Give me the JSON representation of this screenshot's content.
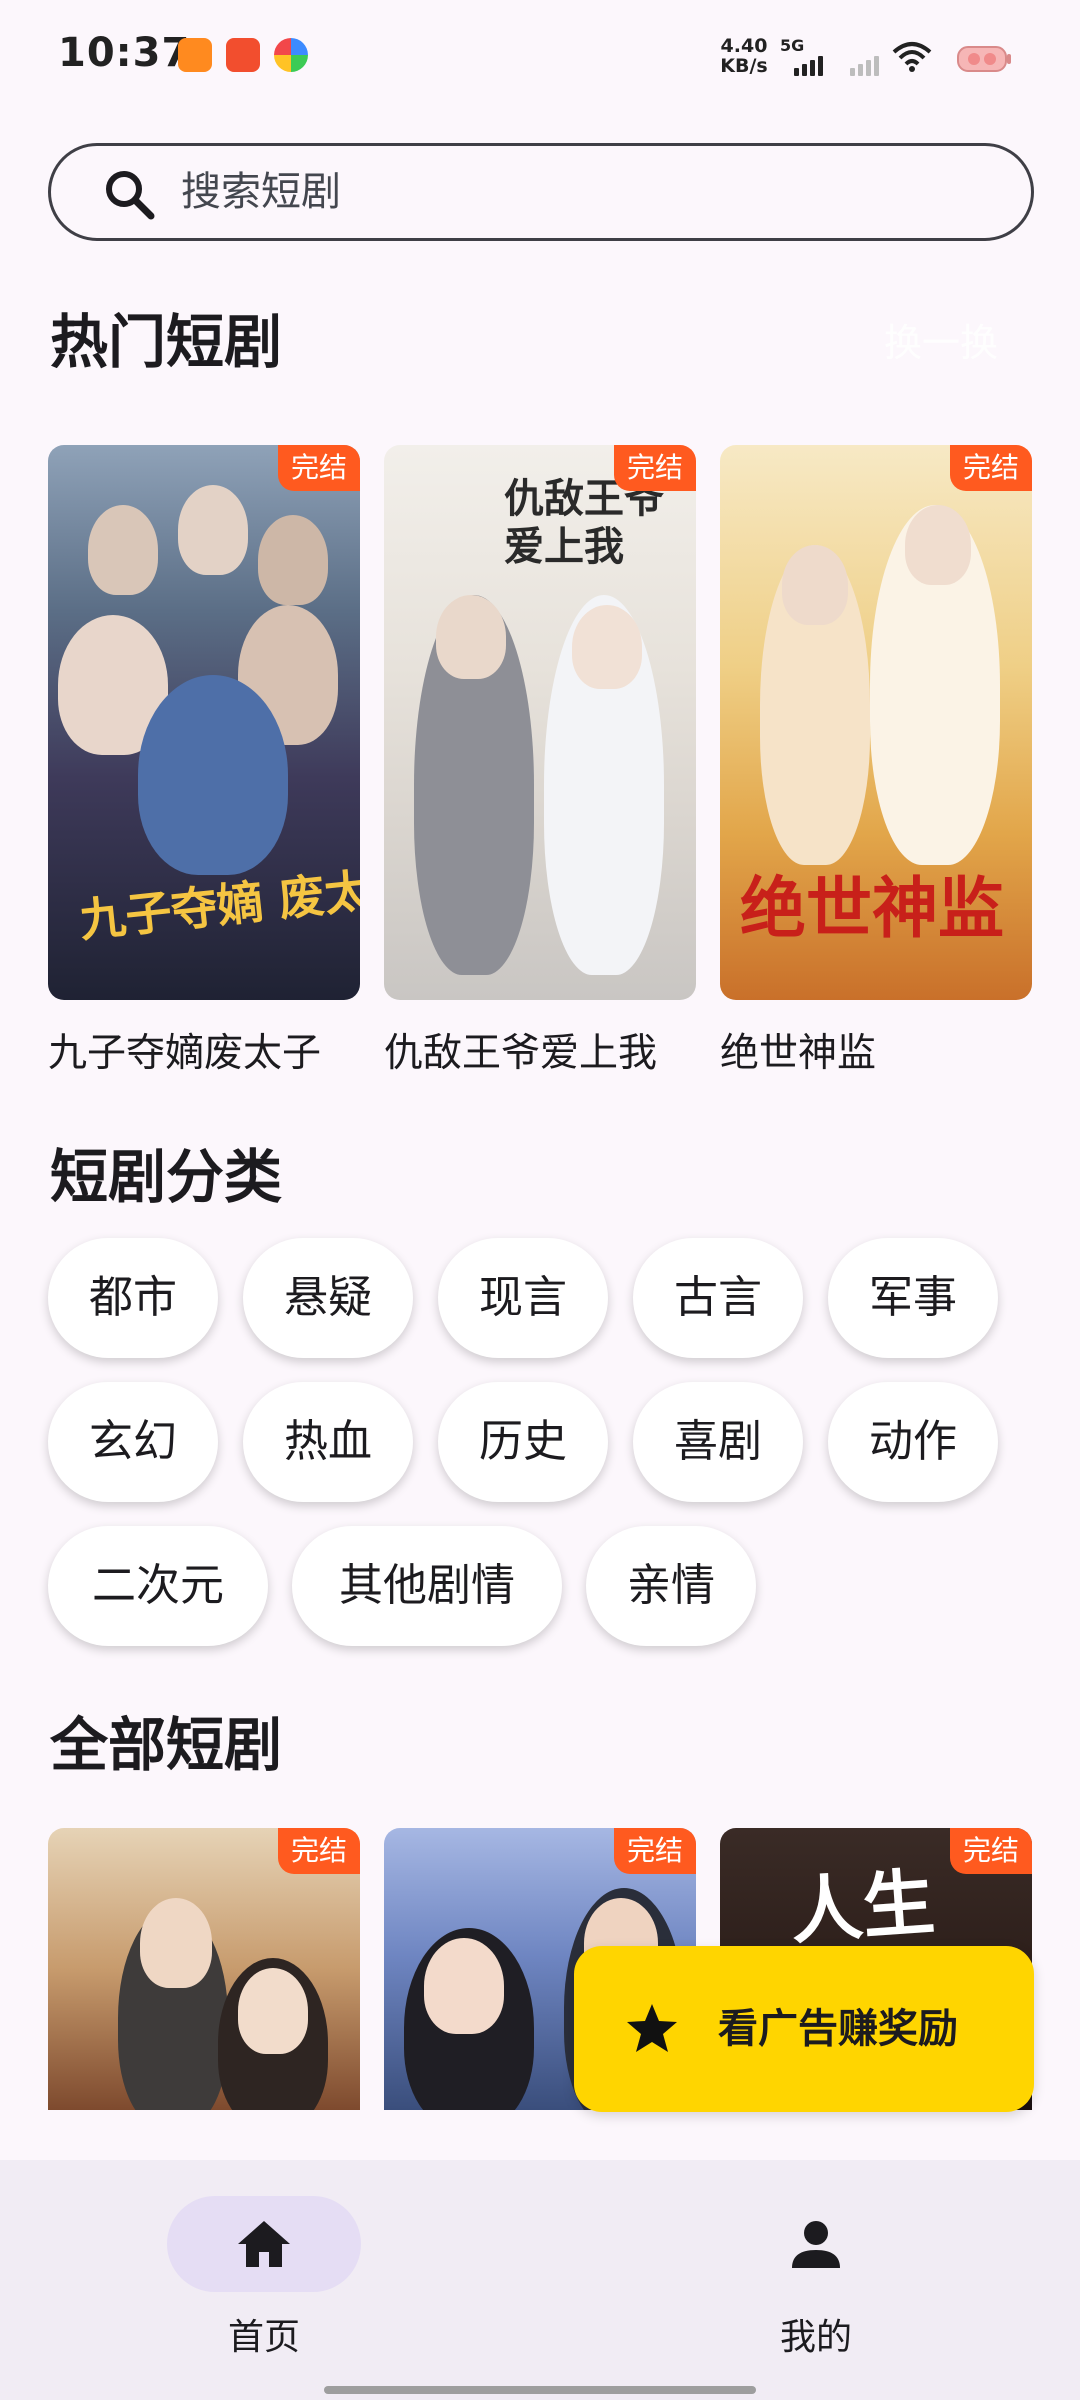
{
  "status_bar": {
    "time": "10:37",
    "net_speed_value": "4.40",
    "net_speed_unit": "KB/s",
    "network": "5G"
  },
  "search": {
    "placeholder": "搜索短剧"
  },
  "hot": {
    "title": "热门短剧",
    "action_label": "换一换",
    "items": [
      {
        "title": "九子夺嫡废太子",
        "badge": "完结",
        "poster_text": "九子夺嫡 废太子竟是修仙者"
      },
      {
        "title": "仇敌王爷爱上我",
        "badge": "完结",
        "poster_text": "仇敌王爷爱上我"
      },
      {
        "title": "绝世神监",
        "badge": "完结",
        "poster_text": "绝世神监"
      }
    ]
  },
  "categories": {
    "title": "短剧分类",
    "items": [
      "都市",
      "悬疑",
      "现言",
      "古言",
      "军事",
      "玄幻",
      "热血",
      "历史",
      "喜剧",
      "动作",
      "二次元",
      "其他剧情",
      "亲情"
    ]
  },
  "all": {
    "title": "全部短剧",
    "items": [
      {
        "badge": "完结"
      },
      {
        "badge": "完结"
      },
      {
        "badge": "完结",
        "poster_text": "人生"
      }
    ]
  },
  "reward": {
    "label": "看广告赚奖励",
    "icon": "star-icon"
  },
  "nav": {
    "items": [
      {
        "label": "首页",
        "icon": "home-icon",
        "active": true
      },
      {
        "label": "我的",
        "icon": "person-icon",
        "active": false
      }
    ]
  },
  "colors": {
    "background": "#FCF7FC",
    "badge": "#FF5A1F",
    "reward": "#FFD500",
    "nav_active": "#E5DDF4"
  }
}
